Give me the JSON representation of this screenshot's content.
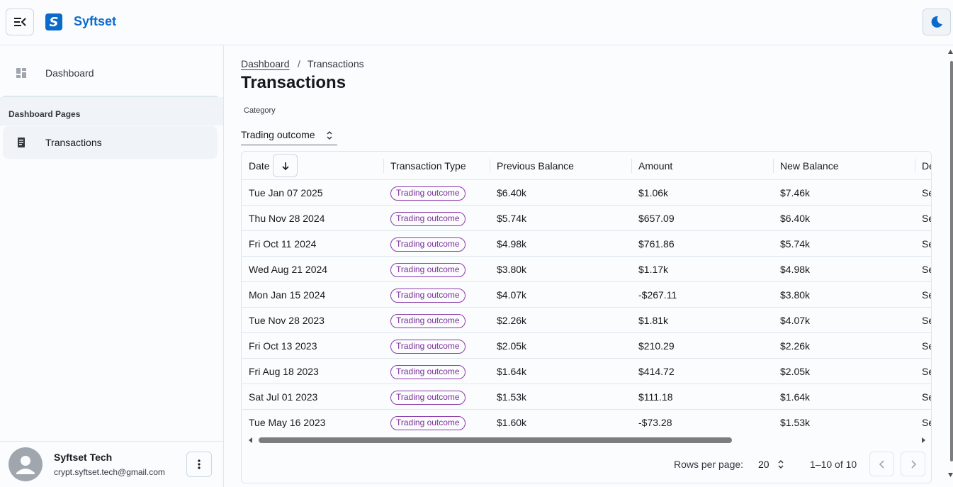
{
  "app": {
    "title": "Syftset",
    "logo_letter": "S",
    "brand_color": "#0b6bcb"
  },
  "sidebar": {
    "items": [
      {
        "label": "Dashboard",
        "icon": "dashboard-grid-icon"
      },
      {
        "label": "Transactions",
        "icon": "receipt-icon"
      }
    ],
    "group_label": "Dashboard Pages",
    "user": {
      "name": "Syftset Tech",
      "email": "crypt.syftset.tech@gmail.com"
    }
  },
  "breadcrumb": {
    "root": "Dashboard",
    "separator": "/",
    "current": "Transactions"
  },
  "page": {
    "title": "Transactions"
  },
  "filter": {
    "label": "Category",
    "value": "Trading outcome"
  },
  "table": {
    "columns": [
      "Date",
      "Transaction Type",
      "Previous Balance",
      "Amount",
      "New Balance",
      "De"
    ],
    "rows": [
      {
        "date": "Tue Jan 07 2025",
        "type": "Trading outcome",
        "prev": "$6.40k",
        "amount": "$1.06k",
        "new": "$7.46k",
        "desc": "Se"
      },
      {
        "date": "Thu Nov 28 2024",
        "type": "Trading outcome",
        "prev": "$5.74k",
        "amount": "$657.09",
        "new": "$6.40k",
        "desc": "Se"
      },
      {
        "date": "Fri Oct 11 2024",
        "type": "Trading outcome",
        "prev": "$4.98k",
        "amount": "$761.86",
        "new": "$5.74k",
        "desc": "Se"
      },
      {
        "date": "Wed Aug 21 2024",
        "type": "Trading outcome",
        "prev": "$3.80k",
        "amount": "$1.17k",
        "new": "$4.98k",
        "desc": "Se"
      },
      {
        "date": "Mon Jan 15 2024",
        "type": "Trading outcome",
        "prev": "$4.07k",
        "amount": "-$267.11",
        "new": "$3.80k",
        "desc": "Se"
      },
      {
        "date": "Tue Nov 28 2023",
        "type": "Trading outcome",
        "prev": "$2.26k",
        "amount": "$1.81k",
        "new": "$4.07k",
        "desc": "Se"
      },
      {
        "date": "Fri Oct 13 2023",
        "type": "Trading outcome",
        "prev": "$2.05k",
        "amount": "$210.29",
        "new": "$2.26k",
        "desc": "Se"
      },
      {
        "date": "Fri Aug 18 2023",
        "type": "Trading outcome",
        "prev": "$1.64k",
        "amount": "$414.72",
        "new": "$2.05k",
        "desc": "Se"
      },
      {
        "date": "Sat Jul 01 2023",
        "type": "Trading outcome",
        "prev": "$1.53k",
        "amount": "$111.18",
        "new": "$1.64k",
        "desc": "Se"
      },
      {
        "date": "Tue May 16 2023",
        "type": "Trading outcome",
        "prev": "$1.60k",
        "amount": "-$73.28",
        "new": "$1.53k",
        "desc": "Se"
      }
    ]
  },
  "pagination": {
    "rows_per_page_label": "Rows per page:",
    "rows_per_page": "20",
    "range": "1–10 of 10"
  },
  "colors": {
    "chip_border": "#8b3aa8",
    "chip_text": "#7a2e96",
    "border": "#dde7ee"
  }
}
